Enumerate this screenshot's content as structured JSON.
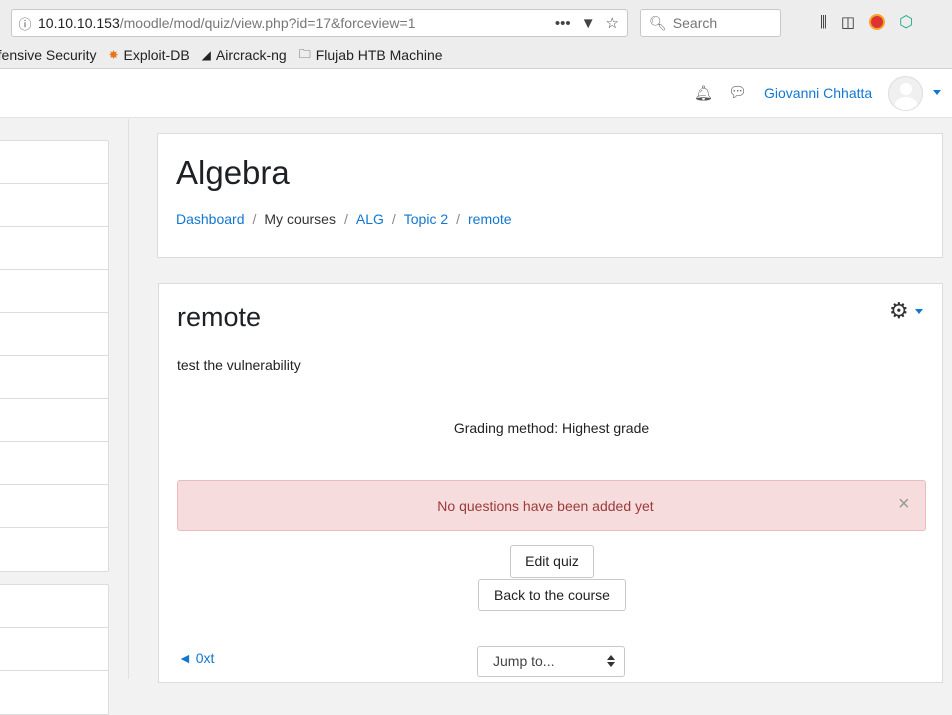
{
  "browser": {
    "url_host": "10.10.10.153",
    "url_path": "/moodle/mod/quiz/view.php?id=17&forceview=1",
    "search_placeholder": "Search",
    "bookmarks": [
      {
        "label": "ffensive Security",
        "icon": "partial-icon"
      },
      {
        "label": "Exploit-DB",
        "icon": "exploit-db-icon"
      },
      {
        "label": "Aircrack-ng",
        "icon": "aircrack-icon"
      },
      {
        "label": "Flujab HTB Machine",
        "icon": "folder-icon"
      }
    ]
  },
  "navbar": {
    "user_name": "Giovanni Chhatta"
  },
  "header": {
    "title": "Algebra",
    "breadcrumb": [
      {
        "label": "Dashboard",
        "link": true
      },
      {
        "label": "My courses",
        "link": false
      },
      {
        "label": "ALG",
        "link": true
      },
      {
        "label": "Topic 2",
        "link": true
      },
      {
        "label": "remote",
        "link": true
      }
    ]
  },
  "quiz": {
    "title": "remote",
    "description": "test the vulnerability",
    "grading_method": "Grading method: Highest grade",
    "alert": "No questions have been added yet",
    "edit_label": "Edit quiz",
    "back_label": "Back to the course",
    "prev_link": "◄ 0xt",
    "jump_label": "Jump to..."
  },
  "colors": {
    "link": "#1177d1",
    "alert_bg": "#f6dcdc",
    "alert_text": "#9a3b3b"
  }
}
